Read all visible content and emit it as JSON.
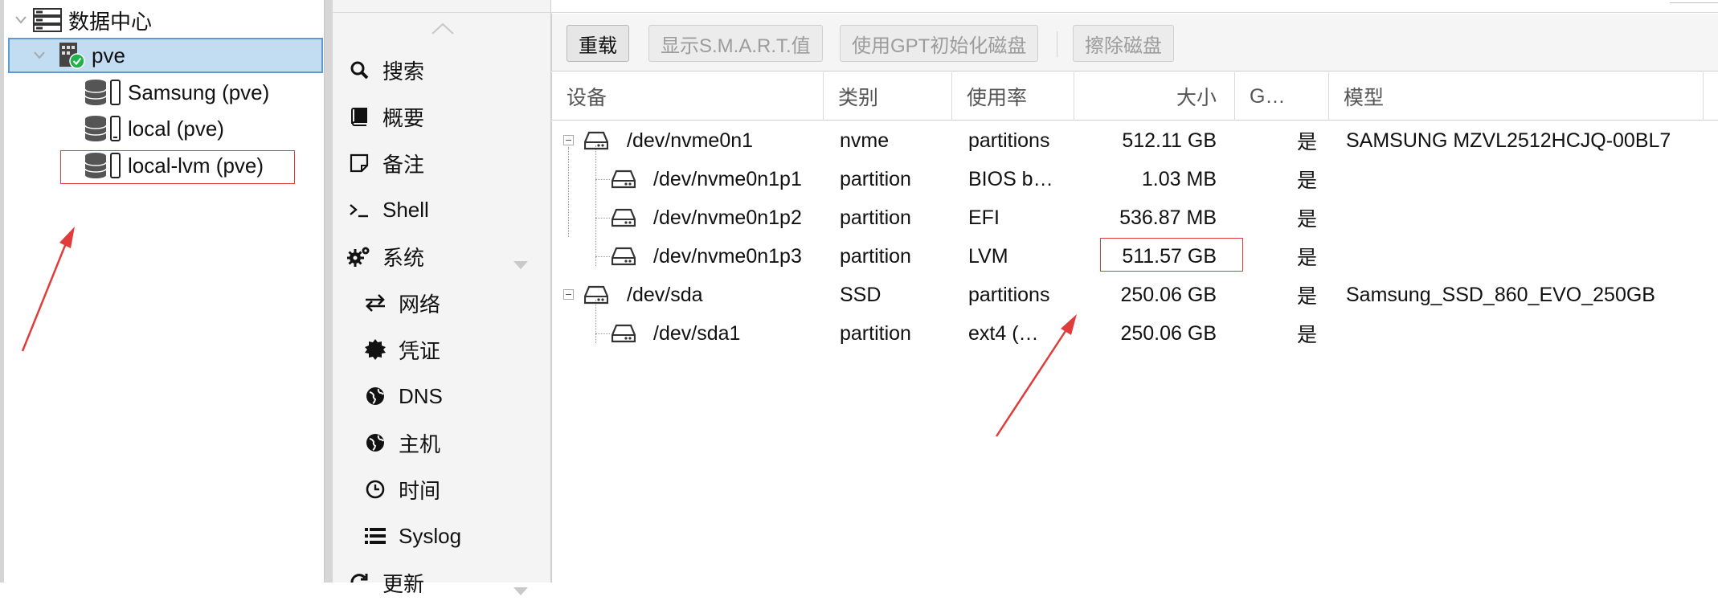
{
  "tree": {
    "root_label": "数据中心",
    "node_label": "pve",
    "storages": [
      {
        "label": "Samsung (pve)"
      },
      {
        "label": "local (pve)"
      },
      {
        "label": "local-lvm (pve)"
      }
    ]
  },
  "nav": {
    "items": [
      {
        "label": "搜索",
        "icon": "search-icon"
      },
      {
        "label": "概要",
        "icon": "book-icon"
      },
      {
        "label": "备注",
        "icon": "note-icon"
      },
      {
        "label": "Shell",
        "icon": "terminal-icon"
      },
      {
        "label": "系统",
        "icon": "gears-icon"
      },
      {
        "label": "网络",
        "icon": "exchange-icon"
      },
      {
        "label": "凭证",
        "icon": "certificate-icon"
      },
      {
        "label": "DNS",
        "icon": "globe-icon"
      },
      {
        "label": "主机",
        "icon": "globe-icon"
      },
      {
        "label": "时间",
        "icon": "clock-icon"
      },
      {
        "label": "Syslog",
        "icon": "list-icon"
      },
      {
        "label": "更新",
        "icon": "refresh-icon"
      }
    ]
  },
  "toolbar": {
    "reload": "重载",
    "smart": "显示S.M.A.R.T.值",
    "gpt": "使用GPT初始化磁盘",
    "wipe": "擦除磁盘"
  },
  "table": {
    "columns": [
      "设备",
      "类别",
      "使用率",
      "大小",
      "G…",
      "模型"
    ],
    "rows": [
      {
        "device": "/dev/nvme0n1",
        "type": "nvme",
        "usage": "partitions",
        "size": "512.11 GB",
        "gpt": "是",
        "model": "SAMSUNG MZVL2512HCJQ-00BL7"
      },
      {
        "device": "/dev/nvme0n1p1",
        "type": "partition",
        "usage": "BIOS b…",
        "size": "1.03 MB",
        "gpt": "是",
        "model": ""
      },
      {
        "device": "/dev/nvme0n1p2",
        "type": "partition",
        "usage": "EFI",
        "size": "536.87 MB",
        "gpt": "是",
        "model": ""
      },
      {
        "device": "/dev/nvme0n1p3",
        "type": "partition",
        "usage": "LVM",
        "size": "511.57 GB",
        "gpt": "是",
        "model": ""
      },
      {
        "device": "/dev/sda",
        "type": "SSD",
        "usage": "partitions",
        "size": "250.06 GB",
        "gpt": "是",
        "model": "Samsung_SSD_860_EVO_250GB"
      },
      {
        "device": "/dev/sda1",
        "type": "partition",
        "usage": "ext4 (…",
        "size": "250.06 GB",
        "gpt": "是",
        "model": ""
      }
    ]
  },
  "colors": {
    "selection": "#c2dcf2",
    "selection_border": "#5b9bd5",
    "annotation_red": "#e03c3c",
    "status_green": "#21b24b"
  }
}
